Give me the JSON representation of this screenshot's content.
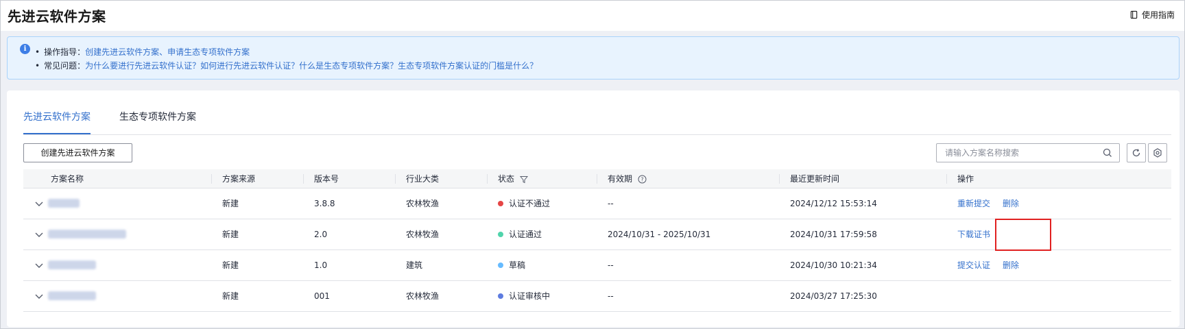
{
  "page": {
    "title": "先进云软件方案",
    "guide_label": "使用指南"
  },
  "notice": {
    "line1_prefix": "操作指导：",
    "line1_links": [
      "创建先进云软件方案",
      "、",
      "申请生态专项软件方案"
    ],
    "line2_prefix": "常见问题：",
    "line2_links": [
      "为什么要进行先进云软件认证？",
      "如何进行先进云软件认证？",
      "什么是生态专项软件方案？",
      "生态专项软件方案认证的门槛是什么？"
    ]
  },
  "tabs": [
    {
      "label": "先进云软件方案",
      "active": true
    },
    {
      "label": "生态专项软件方案",
      "active": false
    }
  ],
  "toolbar": {
    "create_label": "创建先进云软件方案",
    "search_placeholder": "请输入方案名称搜索"
  },
  "table": {
    "headers": [
      "方案名称",
      "方案来源",
      "版本号",
      "行业大类",
      "状态",
      "有效期",
      "最近更新时间",
      "操作"
    ],
    "rows": [
      {
        "source": "新建",
        "version": "3.8.8",
        "industry": "农林牧渔",
        "status": "认证不通过",
        "status_color": "#e54545",
        "validity": "--",
        "updated": "2024/12/12 15:53:14",
        "ops": [
          "重新提交",
          "删除"
        ]
      },
      {
        "source": "新建",
        "version": "2.0",
        "industry": "农林牧渔",
        "status": "认证通过",
        "status_color": "#50d4ab",
        "validity": "2024/10/31 - 2025/10/31",
        "updated": "2024/10/31 17:59:58",
        "ops": [
          "下载证书"
        ]
      },
      {
        "source": "新建",
        "version": "1.0",
        "industry": "建筑",
        "status": "草稿",
        "status_color": "#66bbff",
        "validity": "--",
        "updated": "2024/10/30 10:21:34",
        "ops": [
          "提交认证",
          "删除"
        ]
      },
      {
        "source": "新建",
        "version": "001",
        "industry": "农林牧渔",
        "status": "认证审核中",
        "status_color": "#5e7ce0",
        "validity": "--",
        "updated": "2024/03/27 17:25:30",
        "ops": []
      }
    ]
  },
  "colors": {
    "accent": "#3370cc",
    "notice_bg": "#e8f3fe",
    "highlight": "#e02020"
  }
}
